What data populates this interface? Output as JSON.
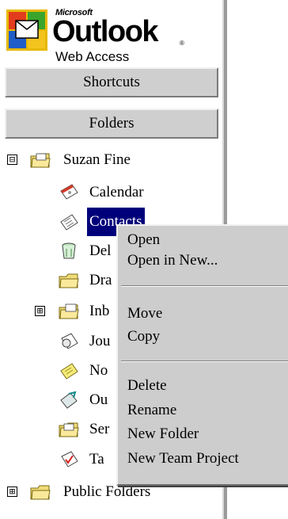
{
  "logo": {
    "microsoft": "Microsoft",
    "product": "Outlook",
    "trademark": "®",
    "subtitle": "Web Access"
  },
  "nav": {
    "shortcuts": "Shortcuts",
    "folders": "Folders"
  },
  "tree": {
    "root_expander": "⊟",
    "root": "Suzan Fine",
    "items": [
      {
        "label": "Calendar",
        "icon": "calendar-icon"
      },
      {
        "label": "Contacts",
        "icon": "contacts-icon",
        "selected": true
      },
      {
        "label": "Del",
        "icon": "deleted-items-icon"
      },
      {
        "label": "Dra",
        "icon": "drafts-folder-icon"
      },
      {
        "label": "Inb",
        "icon": "inbox-icon",
        "expander": "⊞"
      },
      {
        "label": "Jou",
        "icon": "journal-icon"
      },
      {
        "label": "No",
        "icon": "notes-icon"
      },
      {
        "label": "Ou",
        "icon": "outbox-icon"
      },
      {
        "label": "Ser",
        "icon": "sent-items-icon"
      },
      {
        "label": "Ta",
        "icon": "tasks-icon"
      }
    ],
    "public_expander": "⊞",
    "public": "Public Folders"
  },
  "context_menu": {
    "items": [
      "Open",
      "Open in New...",
      "Move",
      "Copy",
      "Delete",
      "Rename",
      "New Folder",
      "New Team Project"
    ]
  },
  "colors": {
    "selection": "#00007b",
    "menu_bg": "#cdcdcd",
    "button_bg": "#cfcfcf"
  }
}
